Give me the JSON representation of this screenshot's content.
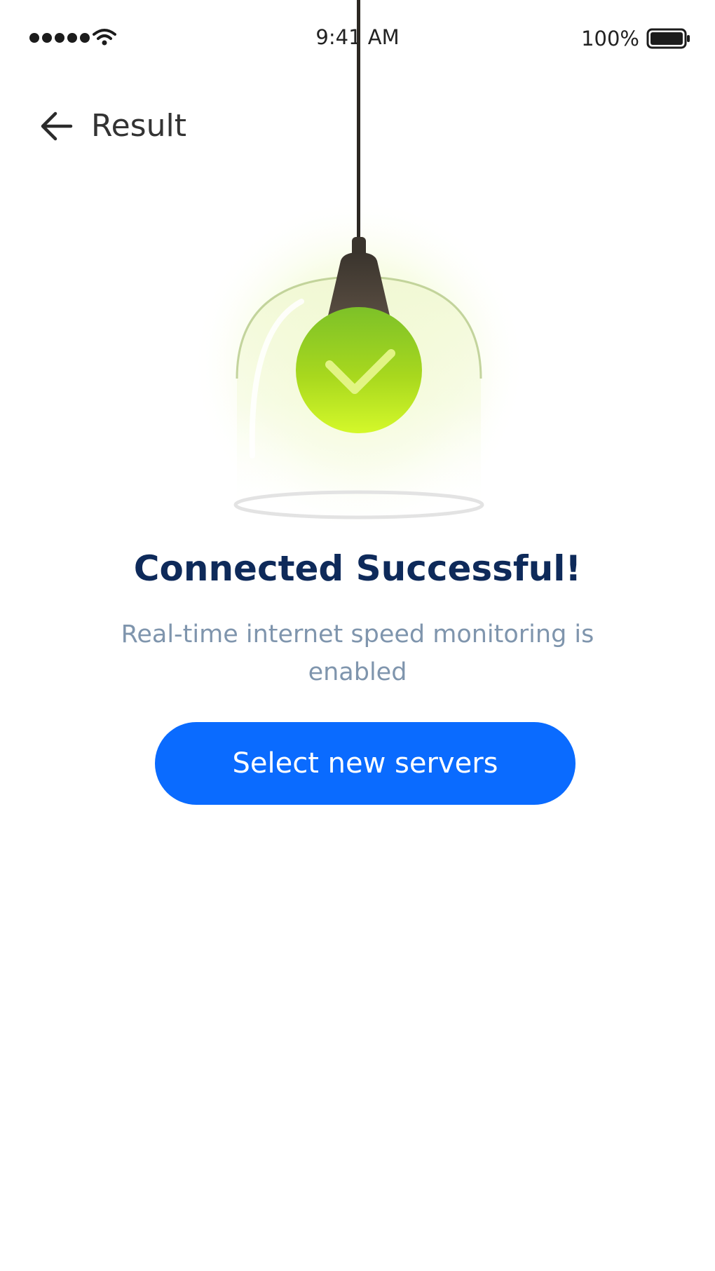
{
  "status_bar": {
    "time": "9:41 AM",
    "battery_percent": "100%",
    "icons": [
      "signal-dots-icon",
      "wifi-icon",
      "battery-icon"
    ]
  },
  "header": {
    "back_icon": "arrow-left-icon",
    "title": "Result"
  },
  "illustration": {
    "icon": "check-icon",
    "description_icon": "hanging-lamp-icon"
  },
  "result": {
    "title": "Connected Successful!",
    "subtitle": "Real-time internet speed monitoring is enabled"
  },
  "actions": {
    "primary_label": "Select new servers"
  },
  "colors": {
    "accent": "#0a6bff",
    "title": "#0e2a5a",
    "subtitle": "#7f95ad",
    "success": "#8bd12a"
  }
}
